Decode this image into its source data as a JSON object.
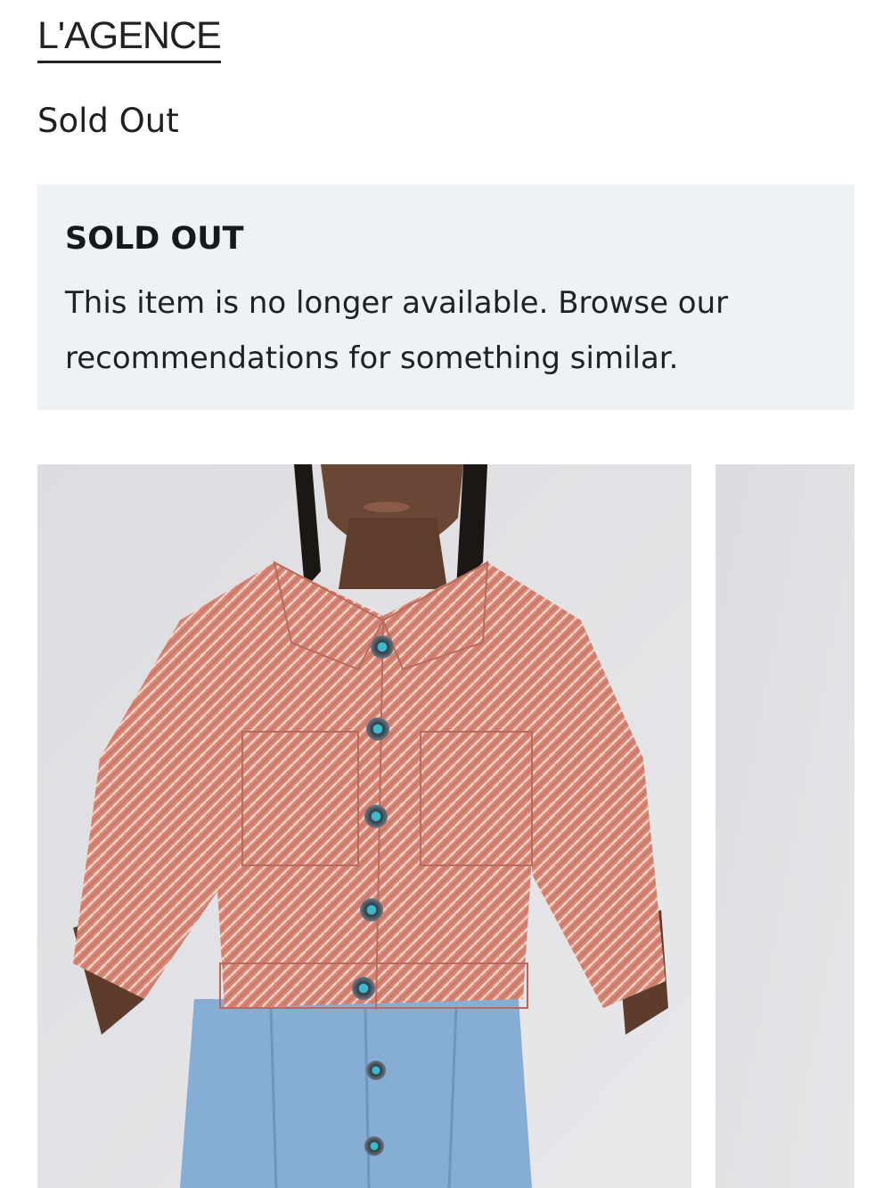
{
  "brand": {
    "name": "L'AGENCE"
  },
  "product": {
    "availability": "Sold Out"
  },
  "notice": {
    "title": "SOLD OUT",
    "message": "This item is no longer available. Browse our recommendations for something similar."
  },
  "gallery": {
    "images": [
      {
        "alt": "Model wearing pink herringbone tweed cropped jacket with turquoise buttons and denim skirt"
      },
      {
        "alt": "Alternate product view"
      }
    ]
  },
  "colors": {
    "notice_background": "#eff2f5",
    "jacket": "#d9877a",
    "denim": "#7fa8cf"
  }
}
